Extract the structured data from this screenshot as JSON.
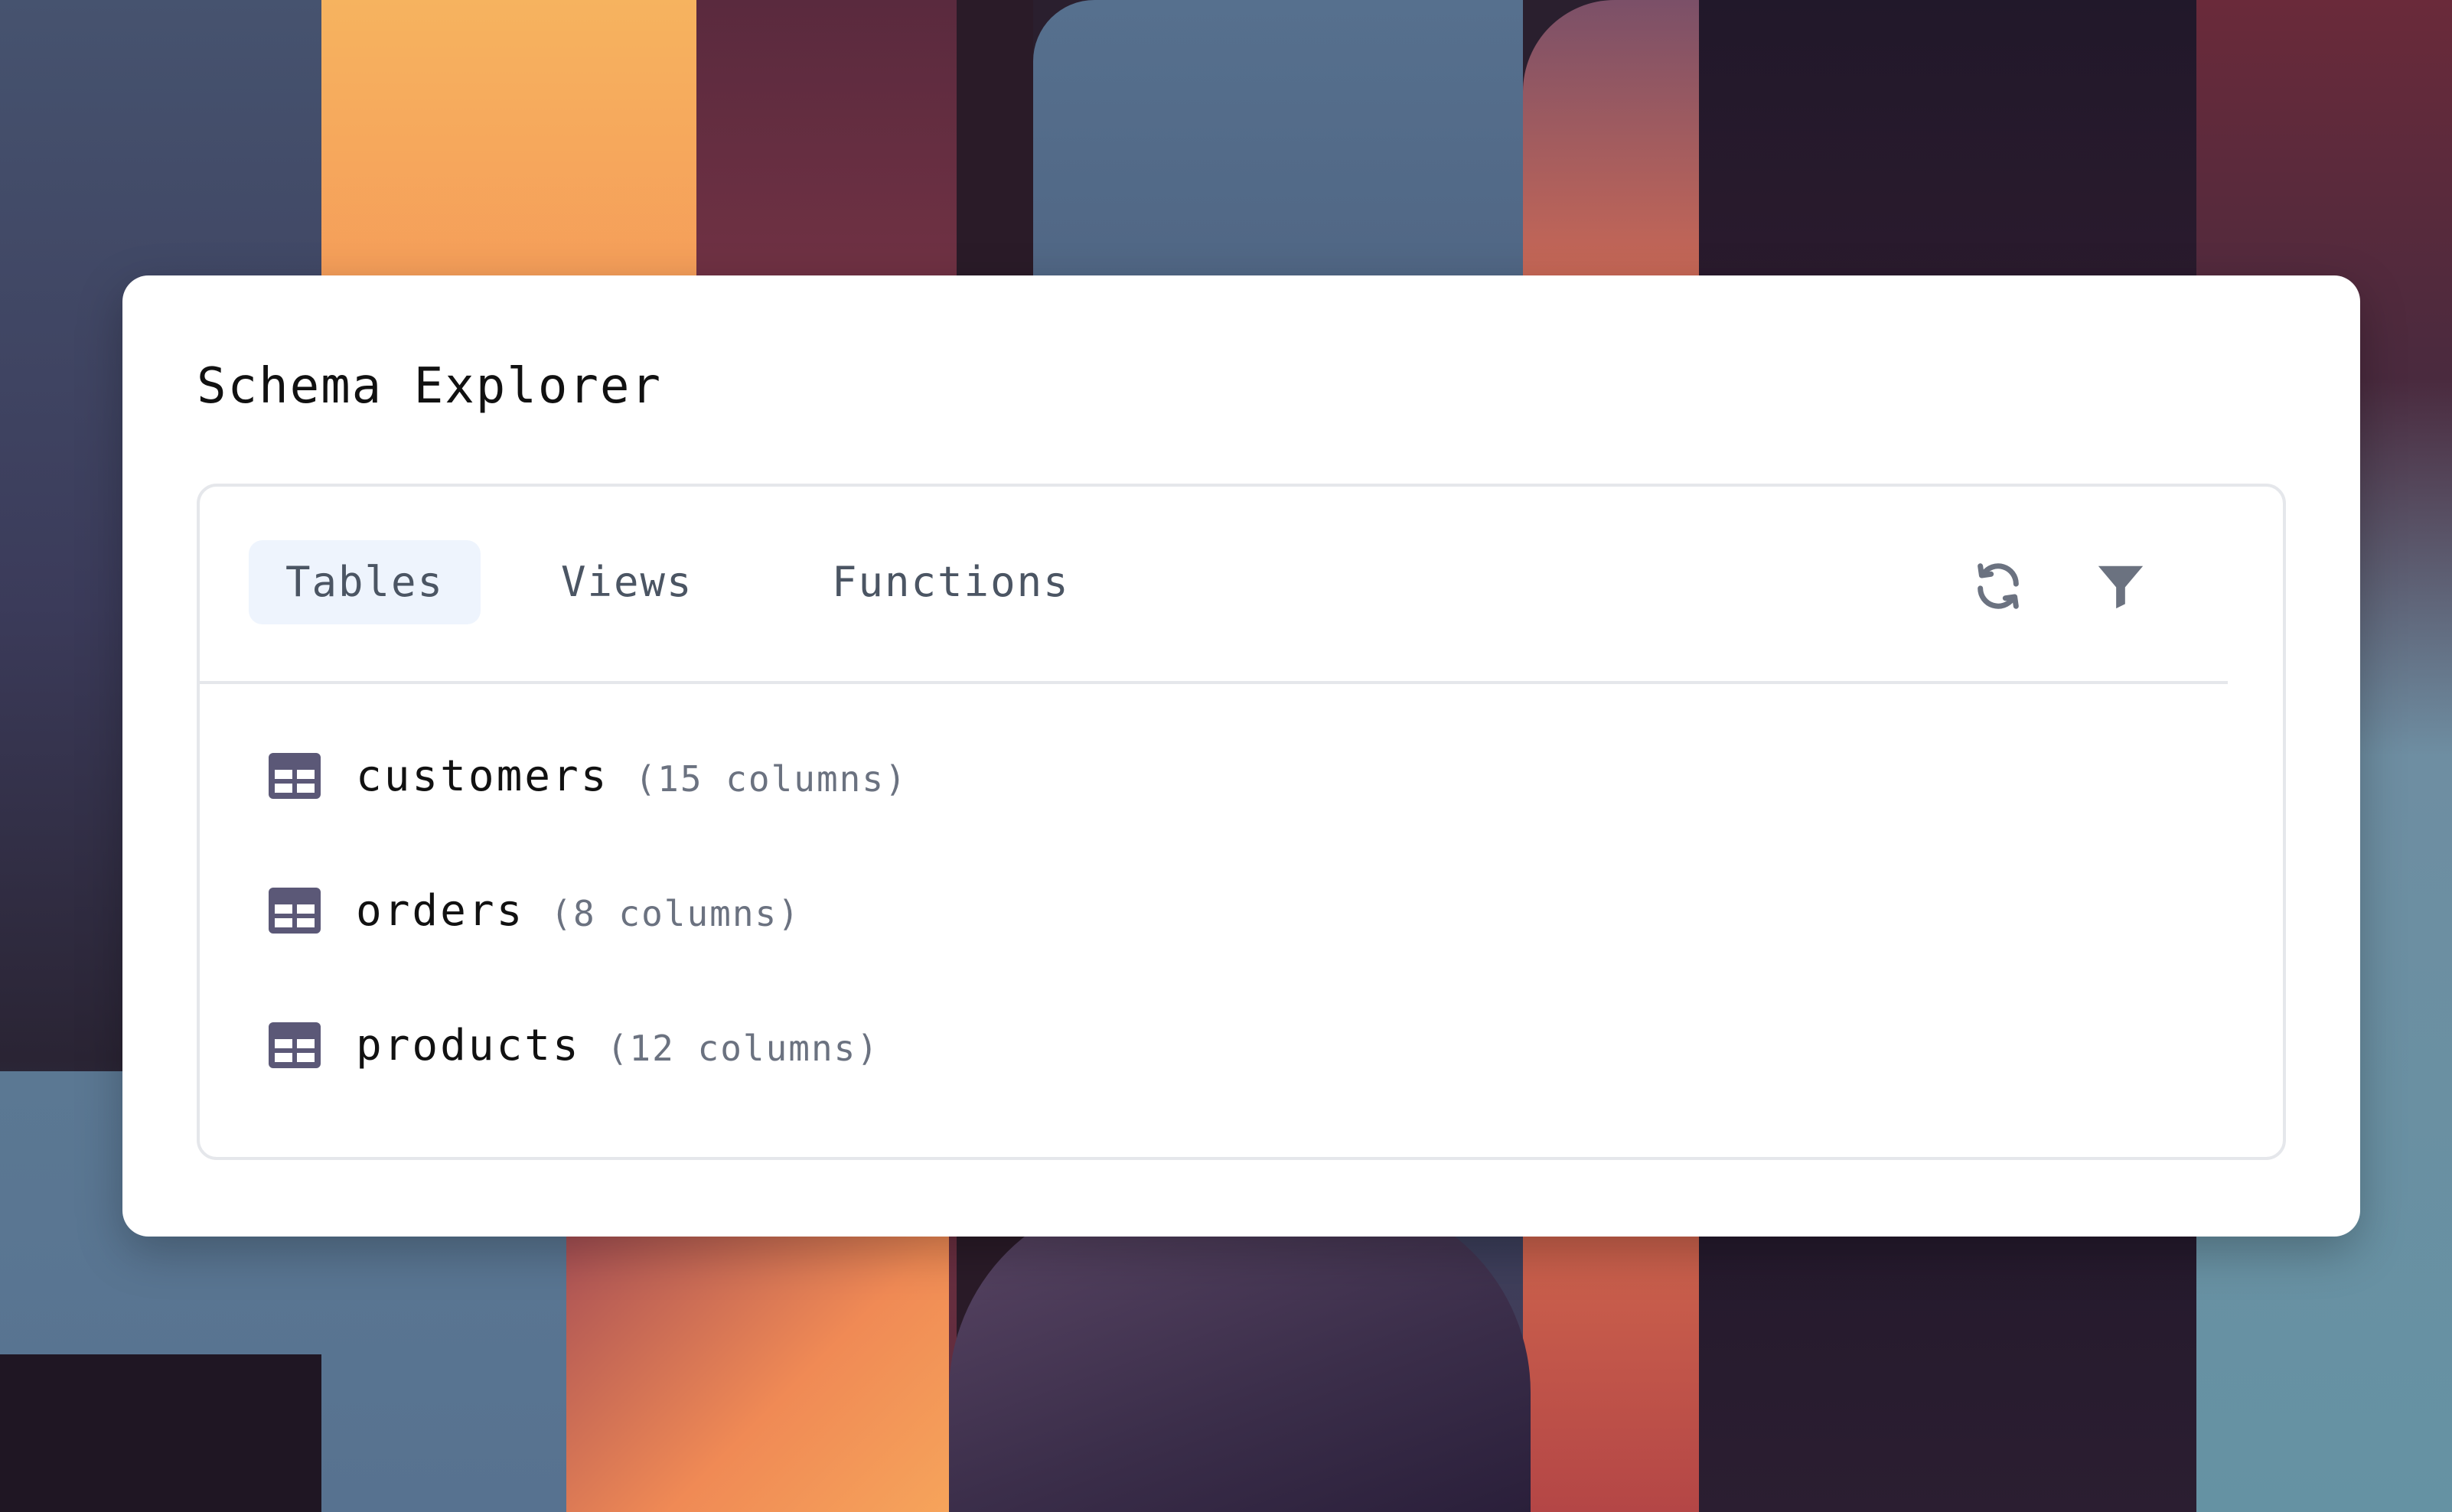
{
  "window": {
    "title": "Schema Explorer"
  },
  "tabs": [
    {
      "label": "Tables",
      "active": true
    },
    {
      "label": "Views",
      "active": false
    },
    {
      "label": "Functions",
      "active": false
    }
  ],
  "toolbar": {
    "refresh_icon": "refresh-icon",
    "filter_icon": "filter-icon"
  },
  "tables": [
    {
      "name": "customers",
      "columns": "(15 columns)",
      "icon": "table-icon"
    },
    {
      "name": "orders",
      "columns": "(8 columns)",
      "icon": "table-icon"
    },
    {
      "name": "products",
      "columns": "(12 columns)",
      "icon": "table-icon"
    }
  ],
  "colors": {
    "active_tab_bg": "#eef4fd",
    "icon_color": "#5b5877",
    "toolbar_icon_color": "#6b7280",
    "border": "#e5e7eb"
  }
}
